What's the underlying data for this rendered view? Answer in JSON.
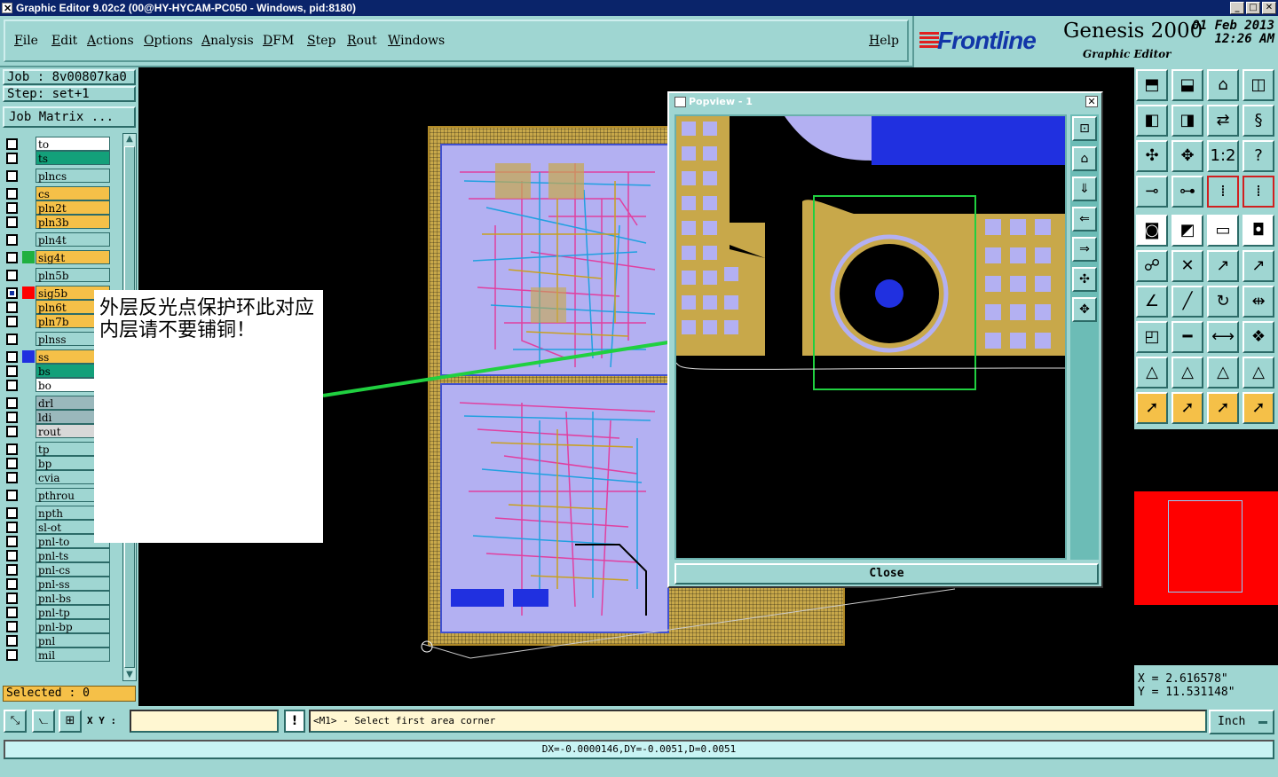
{
  "window": {
    "title": "Graphic Editor 9.02c2 (00@HY-HYCAM-PC050 - Windows, pid:8180)"
  },
  "menu": {
    "items": [
      "File",
      "Edit",
      "Actions",
      "Options",
      "Analysis",
      "DFM",
      "Step",
      "Rout",
      "Windows"
    ],
    "help": "Help"
  },
  "brand": {
    "logo": "Frontline",
    "product": "Genesis 2000",
    "subtitle": "Graphic Editor",
    "date": "01 Feb 2013",
    "time": "12:26 AM"
  },
  "job": {
    "job_line": "Job : 8v00807ka0",
    "step_line": "Step: set+1",
    "matrix_button": "Job Matrix ..."
  },
  "colors": {
    "teal": "#9fd6d2",
    "gold": "#f5c048",
    "green": "#13a07a",
    "red": "#ff0000",
    "blue": "#2030e0",
    "gray": "#9ab8bc",
    "lavender": "#b3b0f2",
    "copper": "#c8a84a"
  },
  "layers": [
    {
      "name": "to",
      "color": "#ffffff"
    },
    {
      "name": "ts",
      "color": "#13a07a"
    },
    {
      "name": "plncs",
      "color": "#9fd6d2"
    },
    {
      "name": "cs",
      "color": "#f5c048"
    },
    {
      "name": "pln2t",
      "color": "#f5c048"
    },
    {
      "name": "pln3b",
      "color": "#f5c048"
    },
    {
      "name": "pln4t",
      "color": "#9fd6d2"
    },
    {
      "name": "sig4t",
      "color": "#f5c048",
      "swatch": "#20b040"
    },
    {
      "name": "pln5b",
      "color": "#9fd6d2"
    },
    {
      "name": "sig5b",
      "color": "#f5c048",
      "swatch": "#ff0000",
      "checked": true
    },
    {
      "name": "pln6t",
      "color": "#f5c048"
    },
    {
      "name": "pln7b",
      "color": "#f5c048"
    },
    {
      "name": "plnss",
      "color": "#9fd6d2"
    },
    {
      "name": "ss",
      "color": "#f5c048",
      "swatch": "#2030e0"
    },
    {
      "name": "bs",
      "color": "#13a07a"
    },
    {
      "name": "bo",
      "color": "#ffffff"
    },
    {
      "name": "drl",
      "color": "#9ab8bc"
    },
    {
      "name": "ldi",
      "color": "#9ab8bc"
    },
    {
      "name": "rout",
      "color": "#d8d8d8"
    },
    {
      "name": "tp",
      "color": "#9fd6d2"
    },
    {
      "name": "bp",
      "color": "#9fd6d2"
    },
    {
      "name": "cvia",
      "color": "#9fd6d2"
    },
    {
      "name": "pthrou",
      "color": "#9fd6d2"
    },
    {
      "name": "npth",
      "color": "#9fd6d2"
    },
    {
      "name": "sl-ot",
      "color": "#9fd6d2"
    },
    {
      "name": "pnl-to",
      "color": "#9fd6d2"
    },
    {
      "name": "pnl-ts",
      "color": "#9fd6d2"
    },
    {
      "name": "pnl-cs",
      "color": "#9fd6d2"
    },
    {
      "name": "pnl-ss",
      "color": "#9fd6d2"
    },
    {
      "name": "pnl-bs",
      "color": "#9fd6d2"
    },
    {
      "name": "pnl-tp",
      "color": "#9fd6d2"
    },
    {
      "name": "pnl-bp",
      "color": "#9fd6d2"
    },
    {
      "name": "pnl",
      "color": "#9fd6d2"
    },
    {
      "name": "mil",
      "color": "#9fd6d2"
    }
  ],
  "selected": "Selected : 0",
  "note": {
    "text": "外层反光点保护环此对应内层请不要铺铜！"
  },
  "popview": {
    "title": "Popview - 1",
    "close_label": "Close"
  },
  "coords": {
    "x": "X = 2.616578\"",
    "y": "Y = 11.531148\""
  },
  "bottom": {
    "xy_label": "X Y :",
    "xy_value": "",
    "prompt": "<M1> - Select first area corner",
    "unit": "Inch",
    "status": "DX=-0.0000146,DY=-0.0051,D=0.0051"
  }
}
